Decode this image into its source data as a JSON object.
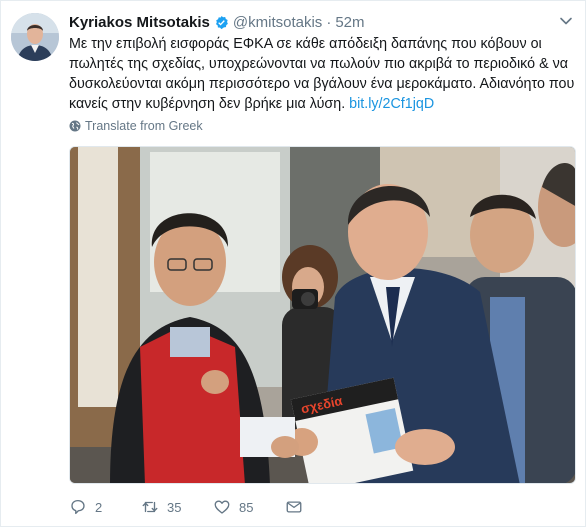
{
  "tweet": {
    "author_name": "Kyriakos Mitsotakis",
    "handle": "@kmitsotakis",
    "separator": "·",
    "time": "52m",
    "text_main": "Με την επιβολή εισφοράς ΕΦΚΑ σε κάθε απόδειξη δαπάνης που κόβουν οι πωλητές της σχεδίας, υποχρεώνονται να πωλούν πιο ακριβά το περιοδικό & να δυσκολεύονται ακόμη περισσότερο να βγάλουν ένα μεροκάματο. Αδιανόητο που κανείς στην κυβέρνηση δεν βρήκε μια λύση.",
    "link": "bit.ly/2Cf1jqD",
    "translate_label": "Translate from Greek",
    "magazine_brand": "σχεδία"
  },
  "actions": {
    "replies": "2",
    "retweets": "35",
    "likes": "85"
  },
  "colors": {
    "link": "#1b95e0",
    "verified": "#1da1f2",
    "secondary_text": "#657786",
    "vest": "#c8282a"
  },
  "icons": [
    "verified-badge-icon",
    "chevron-down-icon",
    "globe-icon",
    "reply-icon",
    "retweet-icon",
    "like-icon",
    "direct-message-icon"
  ]
}
